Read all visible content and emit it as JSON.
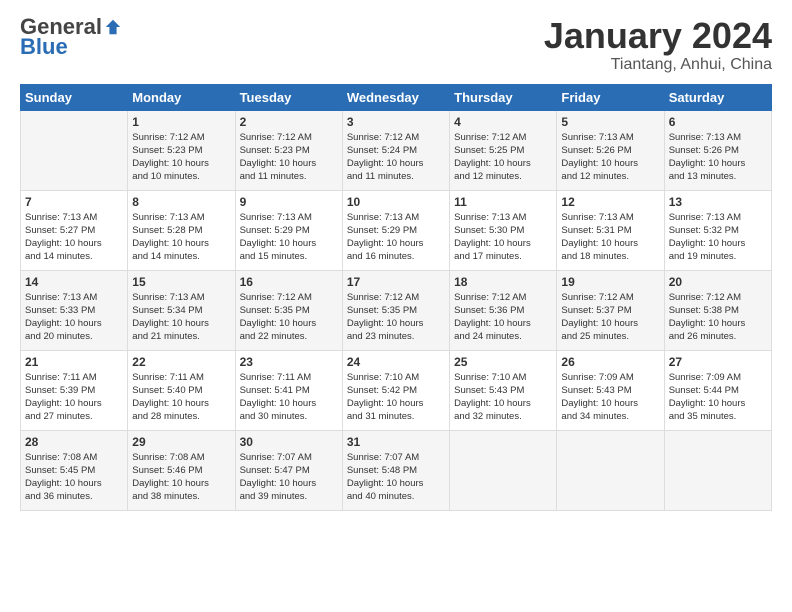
{
  "logo": {
    "general": "General",
    "blue": "Blue"
  },
  "title": "January 2024",
  "location": "Tiantang, Anhui, China",
  "days_header": [
    "Sunday",
    "Monday",
    "Tuesday",
    "Wednesday",
    "Thursday",
    "Friday",
    "Saturday"
  ],
  "weeks": [
    [
      {
        "day": "",
        "info": ""
      },
      {
        "day": "1",
        "info": "Sunrise: 7:12 AM\nSunset: 5:23 PM\nDaylight: 10 hours\nand 10 minutes."
      },
      {
        "day": "2",
        "info": "Sunrise: 7:12 AM\nSunset: 5:23 PM\nDaylight: 10 hours\nand 11 minutes."
      },
      {
        "day": "3",
        "info": "Sunrise: 7:12 AM\nSunset: 5:24 PM\nDaylight: 10 hours\nand 11 minutes."
      },
      {
        "day": "4",
        "info": "Sunrise: 7:12 AM\nSunset: 5:25 PM\nDaylight: 10 hours\nand 12 minutes."
      },
      {
        "day": "5",
        "info": "Sunrise: 7:13 AM\nSunset: 5:26 PM\nDaylight: 10 hours\nand 12 minutes."
      },
      {
        "day": "6",
        "info": "Sunrise: 7:13 AM\nSunset: 5:26 PM\nDaylight: 10 hours\nand 13 minutes."
      }
    ],
    [
      {
        "day": "7",
        "info": "Sunrise: 7:13 AM\nSunset: 5:27 PM\nDaylight: 10 hours\nand 14 minutes."
      },
      {
        "day": "8",
        "info": "Sunrise: 7:13 AM\nSunset: 5:28 PM\nDaylight: 10 hours\nand 14 minutes."
      },
      {
        "day": "9",
        "info": "Sunrise: 7:13 AM\nSunset: 5:29 PM\nDaylight: 10 hours\nand 15 minutes."
      },
      {
        "day": "10",
        "info": "Sunrise: 7:13 AM\nSunset: 5:29 PM\nDaylight: 10 hours\nand 16 minutes."
      },
      {
        "day": "11",
        "info": "Sunrise: 7:13 AM\nSunset: 5:30 PM\nDaylight: 10 hours\nand 17 minutes."
      },
      {
        "day": "12",
        "info": "Sunrise: 7:13 AM\nSunset: 5:31 PM\nDaylight: 10 hours\nand 18 minutes."
      },
      {
        "day": "13",
        "info": "Sunrise: 7:13 AM\nSunset: 5:32 PM\nDaylight: 10 hours\nand 19 minutes."
      }
    ],
    [
      {
        "day": "14",
        "info": "Sunrise: 7:13 AM\nSunset: 5:33 PM\nDaylight: 10 hours\nand 20 minutes."
      },
      {
        "day": "15",
        "info": "Sunrise: 7:13 AM\nSunset: 5:34 PM\nDaylight: 10 hours\nand 21 minutes."
      },
      {
        "day": "16",
        "info": "Sunrise: 7:12 AM\nSunset: 5:35 PM\nDaylight: 10 hours\nand 22 minutes."
      },
      {
        "day": "17",
        "info": "Sunrise: 7:12 AM\nSunset: 5:35 PM\nDaylight: 10 hours\nand 23 minutes."
      },
      {
        "day": "18",
        "info": "Sunrise: 7:12 AM\nSunset: 5:36 PM\nDaylight: 10 hours\nand 24 minutes."
      },
      {
        "day": "19",
        "info": "Sunrise: 7:12 AM\nSunset: 5:37 PM\nDaylight: 10 hours\nand 25 minutes."
      },
      {
        "day": "20",
        "info": "Sunrise: 7:12 AM\nSunset: 5:38 PM\nDaylight: 10 hours\nand 26 minutes."
      }
    ],
    [
      {
        "day": "21",
        "info": "Sunrise: 7:11 AM\nSunset: 5:39 PM\nDaylight: 10 hours\nand 27 minutes."
      },
      {
        "day": "22",
        "info": "Sunrise: 7:11 AM\nSunset: 5:40 PM\nDaylight: 10 hours\nand 28 minutes."
      },
      {
        "day": "23",
        "info": "Sunrise: 7:11 AM\nSunset: 5:41 PM\nDaylight: 10 hours\nand 30 minutes."
      },
      {
        "day": "24",
        "info": "Sunrise: 7:10 AM\nSunset: 5:42 PM\nDaylight: 10 hours\nand 31 minutes."
      },
      {
        "day": "25",
        "info": "Sunrise: 7:10 AM\nSunset: 5:43 PM\nDaylight: 10 hours\nand 32 minutes."
      },
      {
        "day": "26",
        "info": "Sunrise: 7:09 AM\nSunset: 5:43 PM\nDaylight: 10 hours\nand 34 minutes."
      },
      {
        "day": "27",
        "info": "Sunrise: 7:09 AM\nSunset: 5:44 PM\nDaylight: 10 hours\nand 35 minutes."
      }
    ],
    [
      {
        "day": "28",
        "info": "Sunrise: 7:08 AM\nSunset: 5:45 PM\nDaylight: 10 hours\nand 36 minutes."
      },
      {
        "day": "29",
        "info": "Sunrise: 7:08 AM\nSunset: 5:46 PM\nDaylight: 10 hours\nand 38 minutes."
      },
      {
        "day": "30",
        "info": "Sunrise: 7:07 AM\nSunset: 5:47 PM\nDaylight: 10 hours\nand 39 minutes."
      },
      {
        "day": "31",
        "info": "Sunrise: 7:07 AM\nSunset: 5:48 PM\nDaylight: 10 hours\nand 40 minutes."
      },
      {
        "day": "",
        "info": ""
      },
      {
        "day": "",
        "info": ""
      },
      {
        "day": "",
        "info": ""
      }
    ]
  ]
}
